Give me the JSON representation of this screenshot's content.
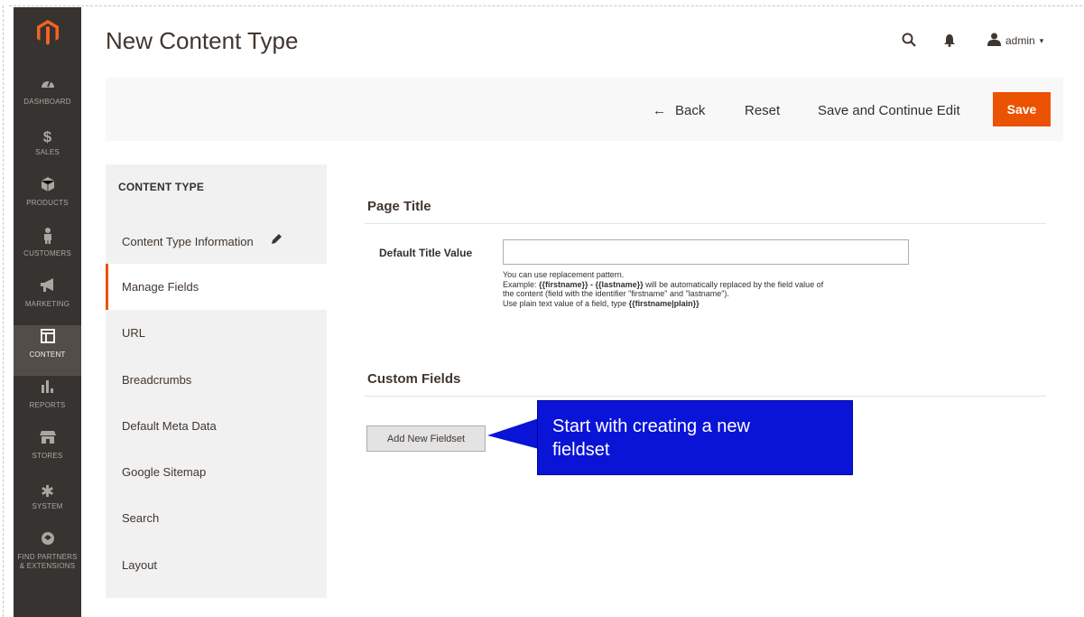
{
  "app": {
    "page_title": "New Content Type",
    "user_name": "admin",
    "user_caret": "▾"
  },
  "nav": {
    "items": [
      {
        "label": "DASHBOARD",
        "icon": "dashboard-icon"
      },
      {
        "label": "SALES",
        "icon": "dollar-icon"
      },
      {
        "label": "PRODUCTS",
        "icon": "cube-icon"
      },
      {
        "label": "CUSTOMERS",
        "icon": "person-icon"
      },
      {
        "label": "MARKETING",
        "icon": "megaphone-icon"
      },
      {
        "label": "CONTENT",
        "icon": "layout-icon",
        "active": true
      },
      {
        "label": "REPORTS",
        "icon": "bar-chart-icon"
      },
      {
        "label": "STORES",
        "icon": "storefront-icon"
      },
      {
        "label": "SYSTEM",
        "icon": "gear-icon"
      },
      {
        "label_1": "FIND PARTNERS",
        "label_2": "& EXTENSIONS",
        "icon": "puzzle-icon"
      }
    ]
  },
  "toolbar": {
    "back_arrow": "←",
    "back_label": "Back",
    "reset_label": "Reset",
    "save_continue_label": "Save and Continue Edit",
    "save_label": "Save"
  },
  "sidepanel": {
    "heading": "CONTENT TYPE",
    "items": [
      {
        "label": "Content Type Information"
      },
      {
        "label": "Manage Fields",
        "active": true
      },
      {
        "label": "URL"
      },
      {
        "label": "Breadcrumbs"
      },
      {
        "label": "Default Meta Data"
      },
      {
        "label": "Google Sitemap"
      },
      {
        "label": "Search"
      },
      {
        "label": "Layout"
      }
    ]
  },
  "page_title_section": {
    "title": "Page Title",
    "field_label": "Default Title Value",
    "field_value": "",
    "note_line1": "You can use replacement pattern.",
    "note_line2_a": "Example: ",
    "note_line2_b": "{{firstname}} - {{lastname}}",
    "note_line2_c": " will be automatically replaced by the field value of",
    "note_line3": "the content (field with the identifier \"firstname\" and \"lastname\").",
    "note_line4_a": "Use plain text value of a field, type ",
    "note_line4_b": "{{firstname|plain}}"
  },
  "custom_fields": {
    "title": "Custom Fields",
    "add_button": "Add New Fieldset"
  },
  "callout": {
    "line1": "Start with creating a new",
    "line2": "fieldset"
  },
  "colors": {
    "accent": "#eb5202",
    "nav_bg": "#373330",
    "callout": "#0a14d6"
  }
}
